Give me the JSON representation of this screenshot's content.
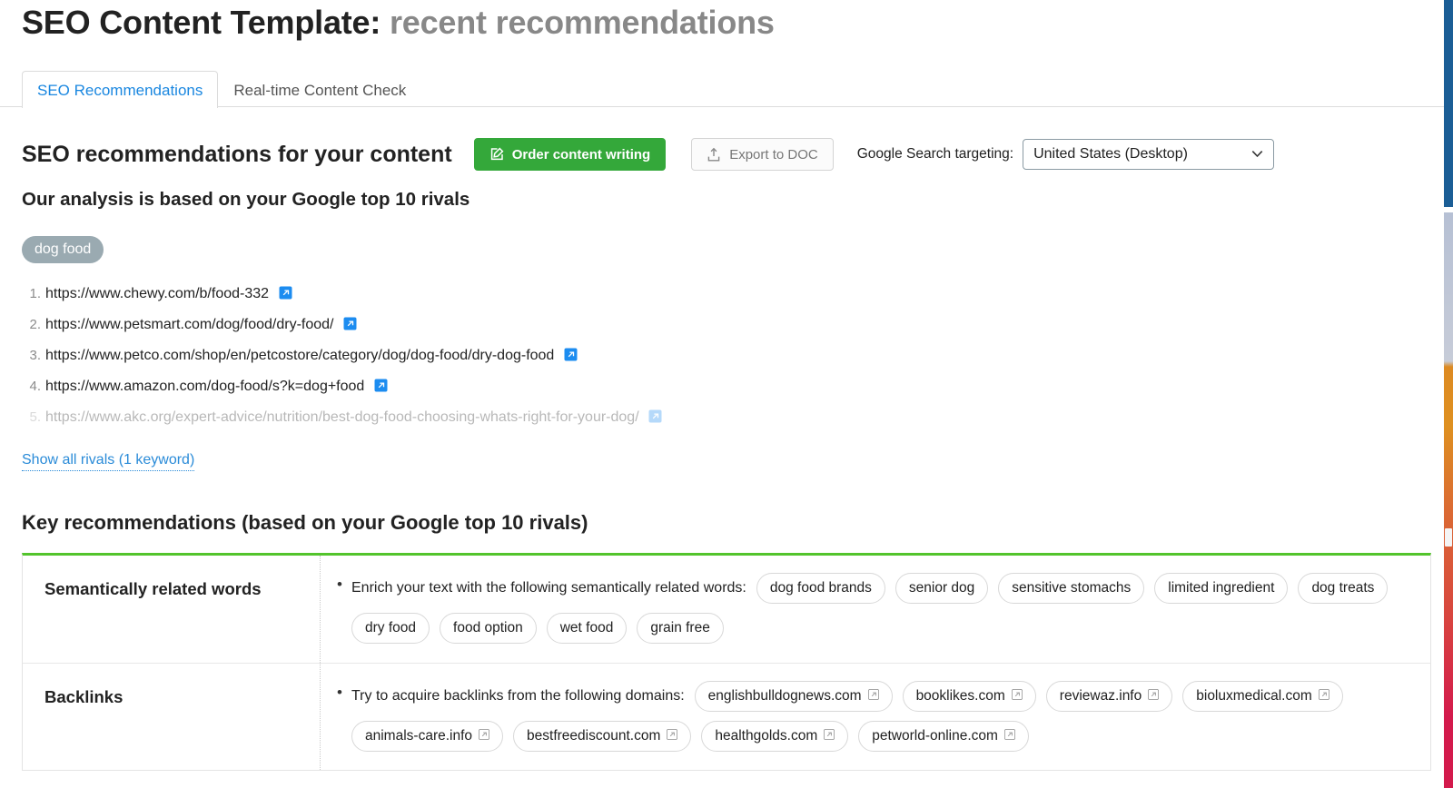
{
  "header": {
    "title_main": "SEO Content Template:",
    "title_sub": "recent recommendations"
  },
  "tabs": [
    {
      "label": "SEO Recommendations",
      "active": true
    },
    {
      "label": "Real-time Content Check",
      "active": false
    }
  ],
  "toolbar": {
    "section_title": "SEO recommendations for your content",
    "order_button": "Order content writing",
    "order_icon": "compose-icon",
    "export_button": "Export to DOC",
    "export_icon": "upload-icon",
    "targeting_label": "Google Search targeting:",
    "targeting_value": "United States (Desktop)",
    "targeting_caret_icon": "chevron-down-icon"
  },
  "analysis": {
    "subtitle": "Our analysis is based on your Google top 10 rivals",
    "keyword_pill": "dog food",
    "rivals": [
      {
        "index": "1.",
        "url": "https://www.chewy.com/b/food-332",
        "faded": false
      },
      {
        "index": "2.",
        "url": "https://www.petsmart.com/dog/food/dry-food/",
        "faded": false
      },
      {
        "index": "3.",
        "url": "https://www.petco.com/shop/en/petcostore/category/dog/dog-food/dry-dog-food",
        "faded": false
      },
      {
        "index": "4.",
        "url": "https://www.amazon.com/dog-food/s?k=dog+food",
        "faded": false
      },
      {
        "index": "5.",
        "url": "https://www.akc.org/expert-advice/nutrition/best-dog-food-choosing-whats-right-for-your-dog/",
        "faded": true
      }
    ],
    "show_all_link": "Show all rivals (1 keyword)"
  },
  "recommendations": {
    "title": "Key recommendations (based on your Google top 10 rivals)",
    "rows": [
      {
        "label": "Semantically related words",
        "lead": "Enrich your text with the following semantically related words:",
        "chips": [
          {
            "text": "dog food brands",
            "external": false
          },
          {
            "text": "senior dog",
            "external": false
          },
          {
            "text": "sensitive stomachs",
            "external": false
          },
          {
            "text": "limited ingredient",
            "external": false
          },
          {
            "text": "dog treats",
            "external": false
          },
          {
            "text": "dry food",
            "external": false
          },
          {
            "text": "food option",
            "external": false
          },
          {
            "text": "wet food",
            "external": false
          },
          {
            "text": "grain free",
            "external": false
          }
        ]
      },
      {
        "label": "Backlinks",
        "lead": "Try to acquire backlinks from the following domains:",
        "chips": [
          {
            "text": "englishbulldognews.com",
            "external": true
          },
          {
            "text": "booklikes.com",
            "external": true
          },
          {
            "text": "reviewaz.info",
            "external": true
          },
          {
            "text": "bioluxmedical.com",
            "external": true
          },
          {
            "text": "animals-care.info",
            "external": true
          },
          {
            "text": "bestfreediscount.com",
            "external": true
          },
          {
            "text": "healthgolds.com",
            "external": true
          },
          {
            "text": "petworld-online.com",
            "external": true
          }
        ]
      }
    ]
  },
  "colors": {
    "accent_blue": "#1a87e0",
    "link_blue": "#2a8bd8",
    "green_button": "#34a83a",
    "green_rule": "#53c42c",
    "pill_gray": "#9aaab1"
  }
}
